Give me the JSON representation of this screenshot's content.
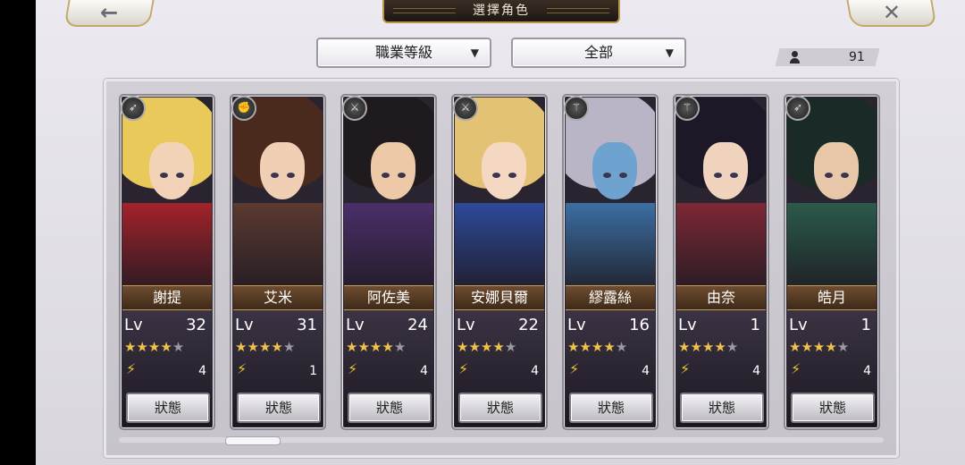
{
  "header": {
    "title": "選擇角色",
    "back_icon": "←",
    "close_icon": "✕"
  },
  "filters": {
    "job_level": "職業等級",
    "scope": "全部",
    "dropdown_arrow": "▼"
  },
  "character_count": "91",
  "characters": [
    {
      "name": "謝提",
      "lv_label": "Lv",
      "level": "32",
      "stars": 4,
      "rank": "4",
      "status": "狀態",
      "hair": "#e8c95a",
      "skin": "#f3d3b8",
      "outfit": "#a3222a",
      "job": "bow-icon"
    },
    {
      "name": "艾米",
      "lv_label": "Lv",
      "level": "31",
      "stars": 4,
      "rank": "1",
      "status": "狀態",
      "hair": "#4b2a1e",
      "skin": "#f0cfb4",
      "outfit": "#5c3a30",
      "job": "fist-icon"
    },
    {
      "name": "阿佐美",
      "lv_label": "Lv",
      "level": "24",
      "stars": 4,
      "rank": "4",
      "status": "狀態",
      "hair": "#1f1a1e",
      "skin": "#edc9a8",
      "outfit": "#4b2f6a",
      "job": "sword-icon"
    },
    {
      "name": "安娜貝爾",
      "lv_label": "Lv",
      "level": "22",
      "stars": 4,
      "rank": "4",
      "status": "狀態",
      "hair": "#e4c274",
      "skin": "#f4d8c2",
      "outfit": "#2d4a9a",
      "job": "sword-icon"
    },
    {
      "name": "繆露絲",
      "lv_label": "Lv",
      "level": "16",
      "stars": 4,
      "rank": "4",
      "status": "狀態",
      "hair": "#b9b4c6",
      "skin": "#6ea3cf",
      "outfit": "#3b6fa3",
      "job": "staff-icon"
    },
    {
      "name": "由奈",
      "lv_label": "Lv",
      "level": "1",
      "stars": 4,
      "rank": "4",
      "status": "狀態",
      "hair": "#1c1828",
      "skin": "#f1d4bd",
      "outfit": "#7d2834",
      "job": "staff-icon"
    },
    {
      "name": "皓月",
      "lv_label": "Lv",
      "level": "1",
      "stars": 4,
      "rank": "4",
      "status": "狀態",
      "hair": "#1a2a26",
      "skin": "#e8c8a8",
      "outfit": "#2a5a4a",
      "job": "bow-icon"
    }
  ],
  "scroll_position": 0.15
}
